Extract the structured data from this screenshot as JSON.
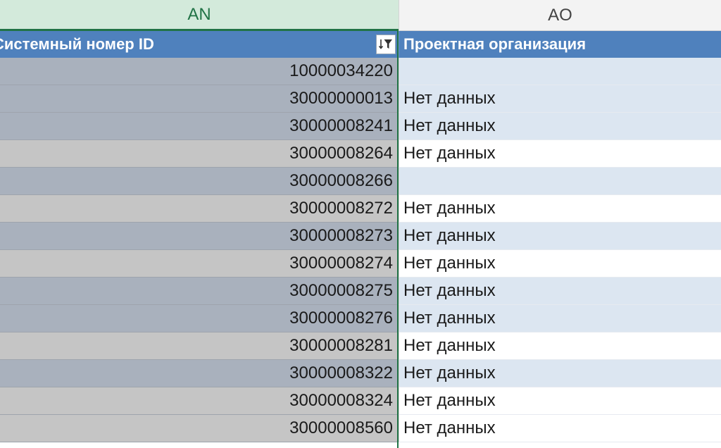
{
  "columns": {
    "an": "AN",
    "ao": "AO"
  },
  "fields": {
    "an": "Системный номер ID",
    "ao": "Проектная организация",
    "filter_icon": "filter-sort-icon"
  },
  "colors": {
    "header_blue": "#4f81bd",
    "selected_green": "#217346",
    "band_blue": "#dce6f1"
  },
  "rows": [
    {
      "id": "10000034220",
      "org": ""
    },
    {
      "id": "30000000013",
      "org": "Нет данных"
    },
    {
      "id": "30000008241",
      "org": "Нет данных"
    },
    {
      "id": "30000008264",
      "org": "Нет данных"
    },
    {
      "id": "30000008266",
      "org": ""
    },
    {
      "id": "30000008272",
      "org": "Нет данных"
    },
    {
      "id": "30000008273",
      "org": "Нет данных"
    },
    {
      "id": "30000008274",
      "org": "Нет данных"
    },
    {
      "id": "30000008275",
      "org": "Нет данных"
    },
    {
      "id": "30000008276",
      "org": "Нет данных"
    },
    {
      "id": "30000008281",
      "org": "Нет данных"
    },
    {
      "id": "30000008322",
      "org": "Нет данных"
    },
    {
      "id": "30000008324",
      "org": "Нет данных"
    },
    {
      "id": "30000008560",
      "org": "Нет данных"
    }
  ]
}
